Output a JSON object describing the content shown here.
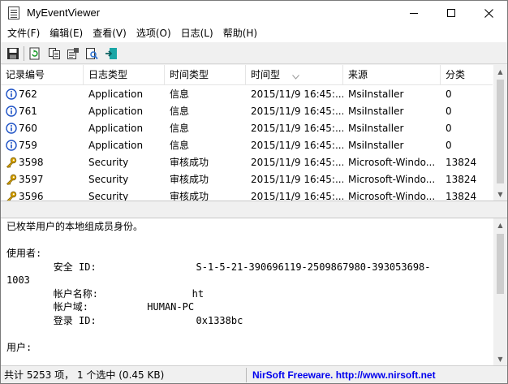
{
  "window": {
    "title": "MyEventViewer"
  },
  "menu": {
    "items": [
      "文件(F)",
      "编辑(E)",
      "查看(V)",
      "选项(O)",
      "日志(L)",
      "帮助(H)"
    ]
  },
  "toolbar": {
    "buttons": [
      "save-icon",
      "refresh-icon",
      "copy-icon",
      "properties-icon",
      "find-icon",
      "exit-icon"
    ]
  },
  "list": {
    "columns": [
      "记录编号",
      "日志类型",
      "时间类型",
      "时间型",
      "来源",
      "分类"
    ],
    "rows": [
      {
        "icon": "info-icon",
        "cells": [
          "762",
          "Application",
          "信息",
          "2015/11/9 16:45:...",
          "MsiInstaller",
          "0"
        ]
      },
      {
        "icon": "info-icon",
        "cells": [
          "761",
          "Application",
          "信息",
          "2015/11/9 16:45:...",
          "MsiInstaller",
          "0"
        ]
      },
      {
        "icon": "info-icon",
        "cells": [
          "760",
          "Application",
          "信息",
          "2015/11/9 16:45:...",
          "MsiInstaller",
          "0"
        ]
      },
      {
        "icon": "info-icon",
        "cells": [
          "759",
          "Application",
          "信息",
          "2015/11/9 16:45:...",
          "MsiInstaller",
          "0"
        ]
      },
      {
        "icon": "key-icon",
        "cells": [
          "3598",
          "Security",
          "审核成功",
          "2015/11/9 16:45:...",
          "Microsoft-Windo...",
          "13824"
        ]
      },
      {
        "icon": "key-icon",
        "cells": [
          "3597",
          "Security",
          "审核成功",
          "2015/11/9 16:45:...",
          "Microsoft-Windo...",
          "13824"
        ]
      },
      {
        "icon": "key-icon",
        "cells": [
          "3596",
          "Security",
          "审核成功",
          "2015/11/9 16:45:...",
          "Microsoft-Windo...",
          "13824"
        ]
      }
    ]
  },
  "detail": {
    "lines": [
      "已枚举用户的本地组成员身份。",
      "",
      "使用者:",
      "        安全 ID:                 S-1-5-21-390696119-2509867980-393053698-",
      "1003",
      "        帐户名称:                ht",
      "        帐户域:          HUMAN-PC",
      "        登录 ID:                 0x1338bc",
      "",
      "用户:"
    ]
  },
  "status": {
    "summary": "共计 5253 项， 1 个选中  (0.45 KB)",
    "link": "NirSoft Freeware.  http://www.nirsoft.net"
  },
  "colors": {
    "link": "#0000ee",
    "info_icon": "#1a4fc4",
    "key_icon": "#d9a400"
  }
}
